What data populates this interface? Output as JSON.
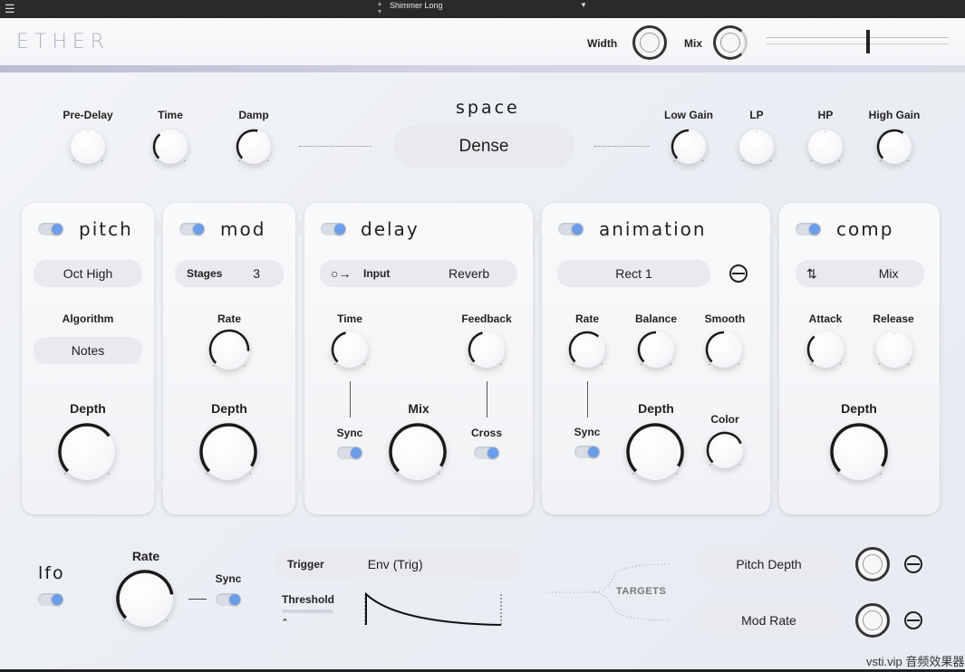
{
  "topbar": {
    "menu_icon": "hamburger-icon",
    "preset": "Shimmer Long",
    "arrows_icon": "updown-icon",
    "caret_icon": "caret-down-icon"
  },
  "header": {
    "logo": "ETHER",
    "width_label": "Width",
    "mix_label": "Mix",
    "width_value": 0.95,
    "mix_value": 0.85,
    "slider_value": 0.55
  },
  "space": {
    "title": "space",
    "mode": "Dense",
    "knobs": [
      {
        "label": "Pre-Delay",
        "value": 0.0
      },
      {
        "label": "Time",
        "value": 0.35
      },
      {
        "label": "Damp",
        "value": 0.55
      },
      {
        "label": "Low Gain",
        "value": 0.5
      },
      {
        "label": "LP",
        "value": 0.0
      },
      {
        "label": "HP",
        "value": 0.0
      },
      {
        "label": "High Gain",
        "value": 0.62
      }
    ]
  },
  "pitch": {
    "title": "pitch",
    "enabled": true,
    "mode": "Oct High",
    "algorithm_label": "Algorithm",
    "algorithm": "Notes",
    "depth_label": "Depth",
    "depth": 0.7
  },
  "mod": {
    "title": "mod",
    "enabled": true,
    "stages_label": "Stages",
    "stages": "3",
    "rate_label": "Rate",
    "rate": 0.85,
    "depth_label": "Depth",
    "depth": 0.95
  },
  "delay": {
    "title": "delay",
    "enabled": true,
    "input_icon": "input-routing-icon",
    "input_label": "Input",
    "input": "Reverb",
    "time_label": "Time",
    "time": 0.45,
    "feedback_label": "Feedback",
    "feedback": 0.45,
    "sync_label": "Sync",
    "mix_label": "Mix",
    "mix": 0.95,
    "cross_label": "Cross"
  },
  "animation": {
    "title": "animation",
    "enabled": true,
    "shape": "Rect 1",
    "shape_icon": "circle-line-icon",
    "rate_label": "Rate",
    "rate": 0.65,
    "balance_label": "Balance",
    "balance": 0.5,
    "smooth_label": "Smooth",
    "smooth": 0.5,
    "sync_label": "Sync",
    "depth_label": "Depth",
    "depth": 0.95,
    "color_label": "Color",
    "color": 0.75
  },
  "comp": {
    "title": "comp",
    "enabled": true,
    "route_icon": "route-icon",
    "mode": "Mix",
    "attack_label": "Attack",
    "attack": 0.35,
    "release_label": "Release",
    "release": 0.0,
    "depth_label": "Depth",
    "depth": 0.95
  },
  "lfo": {
    "title": "lfo",
    "enabled": true,
    "rate_label": "Rate",
    "rate": 0.8,
    "sync_label": "Sync",
    "trigger_label": "Trigger",
    "trigger": "Env (Trig)",
    "threshold_label": "Threshold",
    "threshold_icon": "caret-up-icon",
    "targets_label": "TARGETS",
    "targets": [
      {
        "label": "Pitch Depth",
        "amount": 0.95,
        "icon": "circle-line-icon"
      },
      {
        "label": "Mod Rate",
        "amount": 0.95,
        "icon": "circle-line-icon"
      }
    ]
  },
  "watermark": "vsti.vip 音频效果器",
  "colors": {
    "accent": "#6c9de8",
    "panel": "#f5f6f8",
    "topbar": "#2a2a2a"
  }
}
